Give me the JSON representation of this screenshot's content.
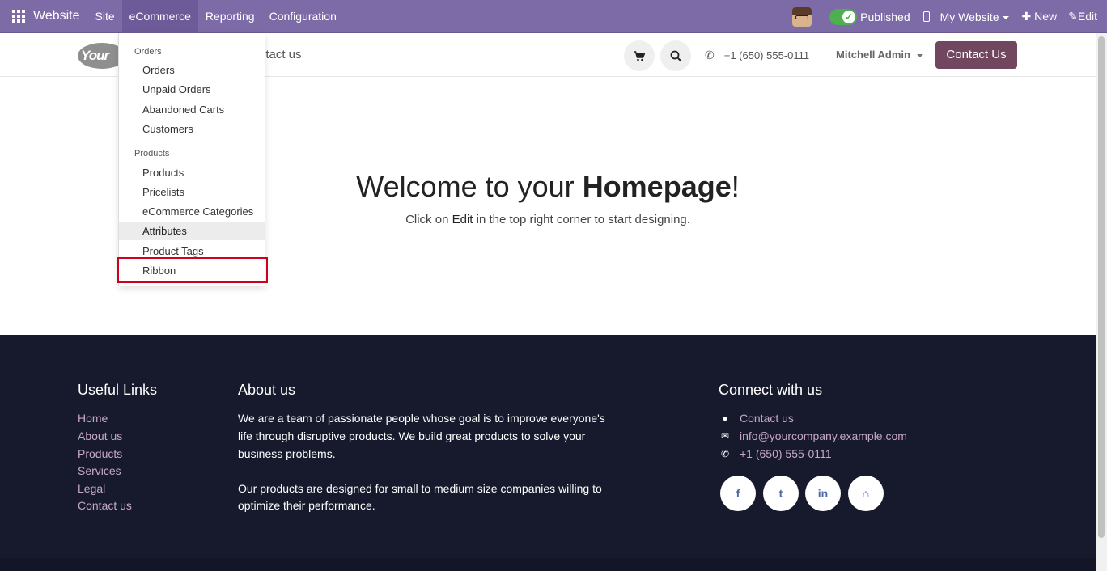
{
  "topbar": {
    "app_name": "Website",
    "menu": [
      "Site",
      "eCommerce",
      "Reporting",
      "Configuration"
    ],
    "published_label": "Published",
    "my_website_label": "My Website",
    "new_label": "New",
    "edit_label": "Edit"
  },
  "header": {
    "logo_text": "Your",
    "nav_contact": "ntact us",
    "phone": "+1 (650) 555-0111",
    "user": "Mitchell Admin",
    "contact_button": "Contact Us"
  },
  "dropdown": {
    "sections": [
      {
        "title": "Orders",
        "items": [
          "Orders",
          "Unpaid Orders",
          "Abandoned Carts",
          "Customers"
        ]
      },
      {
        "title": "Products",
        "items": [
          "Products",
          "Pricelists",
          "eCommerce Categories",
          "Attributes",
          "Product Tags",
          "Ribbon"
        ]
      }
    ],
    "hovered": "Attributes",
    "highlighted": "Ribbon"
  },
  "hero": {
    "title_prefix": "Welcome to your ",
    "title_bold": "Homepage",
    "title_suffix": "!",
    "sub_prefix": "Click on ",
    "sub_edit": "Edit",
    "sub_suffix": " in the top right corner to start designing."
  },
  "footer": {
    "useful_links_title": "Useful Links",
    "useful_links": [
      "Home",
      "About us",
      "Products",
      "Services",
      "Legal",
      "Contact us"
    ],
    "about_title": "About us",
    "about_p1_lines": [
      "We are a team of passionate people whose goal is to improve everyone's",
      "life through disruptive products. We build great products to solve your",
      "business problems."
    ],
    "about_p2_lines": [
      "Our products are designed for small to medium size companies willing to",
      "optimize their performance."
    ],
    "connect_title": "Connect with us",
    "connect_items": [
      {
        "icon": "comment-icon",
        "text": "Contact us"
      },
      {
        "icon": "envelope-icon",
        "text": "info@yourcompany.example.com"
      },
      {
        "icon": "phone-icon",
        "text": "+1 (650) 555-0111"
      }
    ],
    "social": [
      {
        "icon": "facebook-icon",
        "glyph": "f"
      },
      {
        "icon": "twitter-icon",
        "glyph": "t"
      },
      {
        "icon": "linkedin-icon",
        "glyph": "in"
      },
      {
        "icon": "home-icon",
        "glyph": "⌂"
      }
    ]
  },
  "colors": {
    "topbar": "#7c6ba6",
    "contact_button": "#71465f",
    "footer": "#161a2c",
    "footer_link": "#c8a8c4",
    "highlight_box": "#d0021b"
  }
}
